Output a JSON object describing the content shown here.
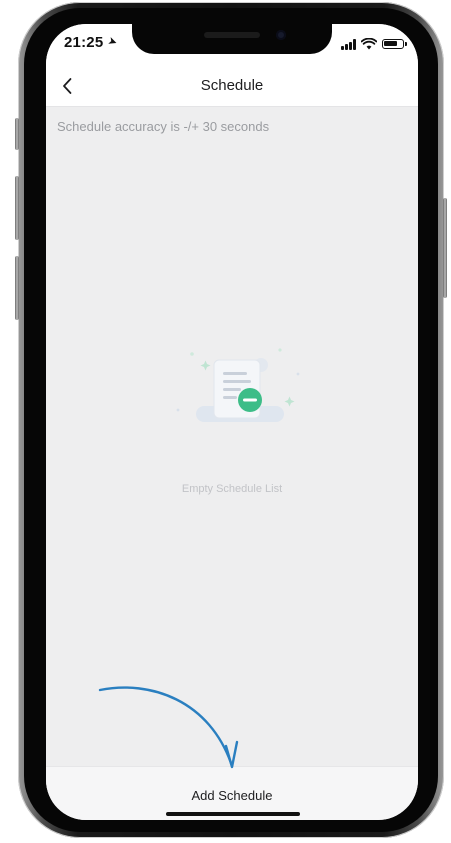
{
  "status_bar": {
    "time": "21:25",
    "location_icon": "location-arrow-icon",
    "icons": [
      "signal-bars-icon",
      "wifi-icon",
      "battery-icon"
    ],
    "battery_level": 0.8
  },
  "nav": {
    "back_icon": "chevron-left-icon",
    "title": "Schedule"
  },
  "main": {
    "accuracy_note": "Schedule accuracy is -/+ 30 seconds",
    "empty_illustration_icon": "empty-schedule-document-icon",
    "empty_text": "Empty Schedule List"
  },
  "footer": {
    "add_label": "Add Schedule"
  },
  "colors": {
    "screen_bg": "#eeeeef",
    "accent_green": "#36b37e",
    "annotation_arrow": "#2a7fc0"
  }
}
